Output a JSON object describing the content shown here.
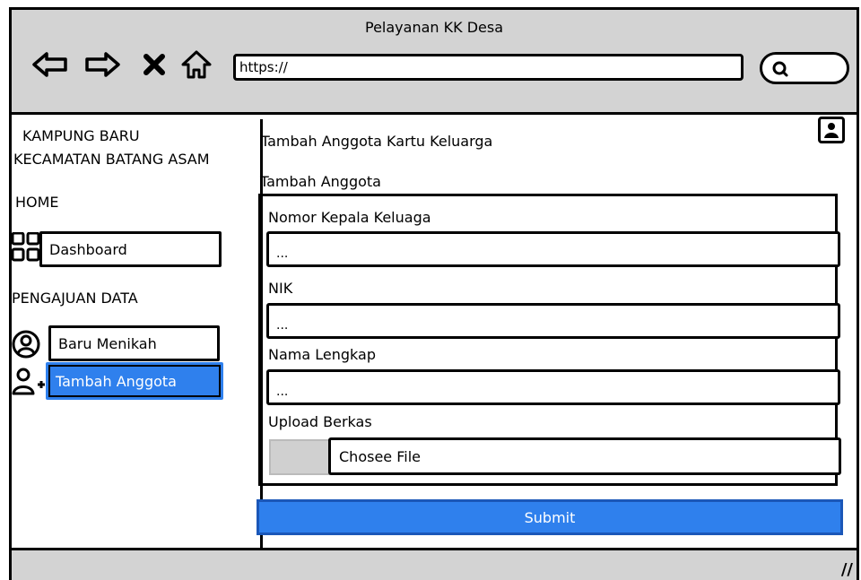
{
  "window": {
    "title": "Pelayanan KK Desa"
  },
  "browser": {
    "url": "https://",
    "icons": [
      "back-arrow-icon",
      "forward-arrow-icon",
      "close-icon",
      "home-icon",
      "search-icon"
    ]
  },
  "sidebar": {
    "title_line1": "KAMPUNG BARU",
    "title_line2": "KECAMATAN BATANG ASAM",
    "home_heading": "HOME",
    "dashboard_label": "Dashboard",
    "pengajuan_heading": "PENGAJUAN DATA",
    "items": [
      {
        "label": "Baru Menikah",
        "icon": "user-circle-icon",
        "active": false
      },
      {
        "label": "Tambah Anggota",
        "icon": "add-user-icon",
        "active": true
      }
    ]
  },
  "main": {
    "page_title": "Tambah Anggota Kartu Keluarga",
    "section_label": "Tambah Anggota",
    "fields": [
      {
        "label": "Nomor Kepala Keluaga",
        "value": "..."
      },
      {
        "label": "NIK",
        "value": "..."
      },
      {
        "label": "Nama Lengkap",
        "value": "..."
      }
    ],
    "upload_label": "Upload Berkas",
    "file_button": "Chosee File",
    "submit_label": "Submit"
  },
  "colors": {
    "accent": "#2f80ed",
    "chrome": "#d3d3d3"
  }
}
